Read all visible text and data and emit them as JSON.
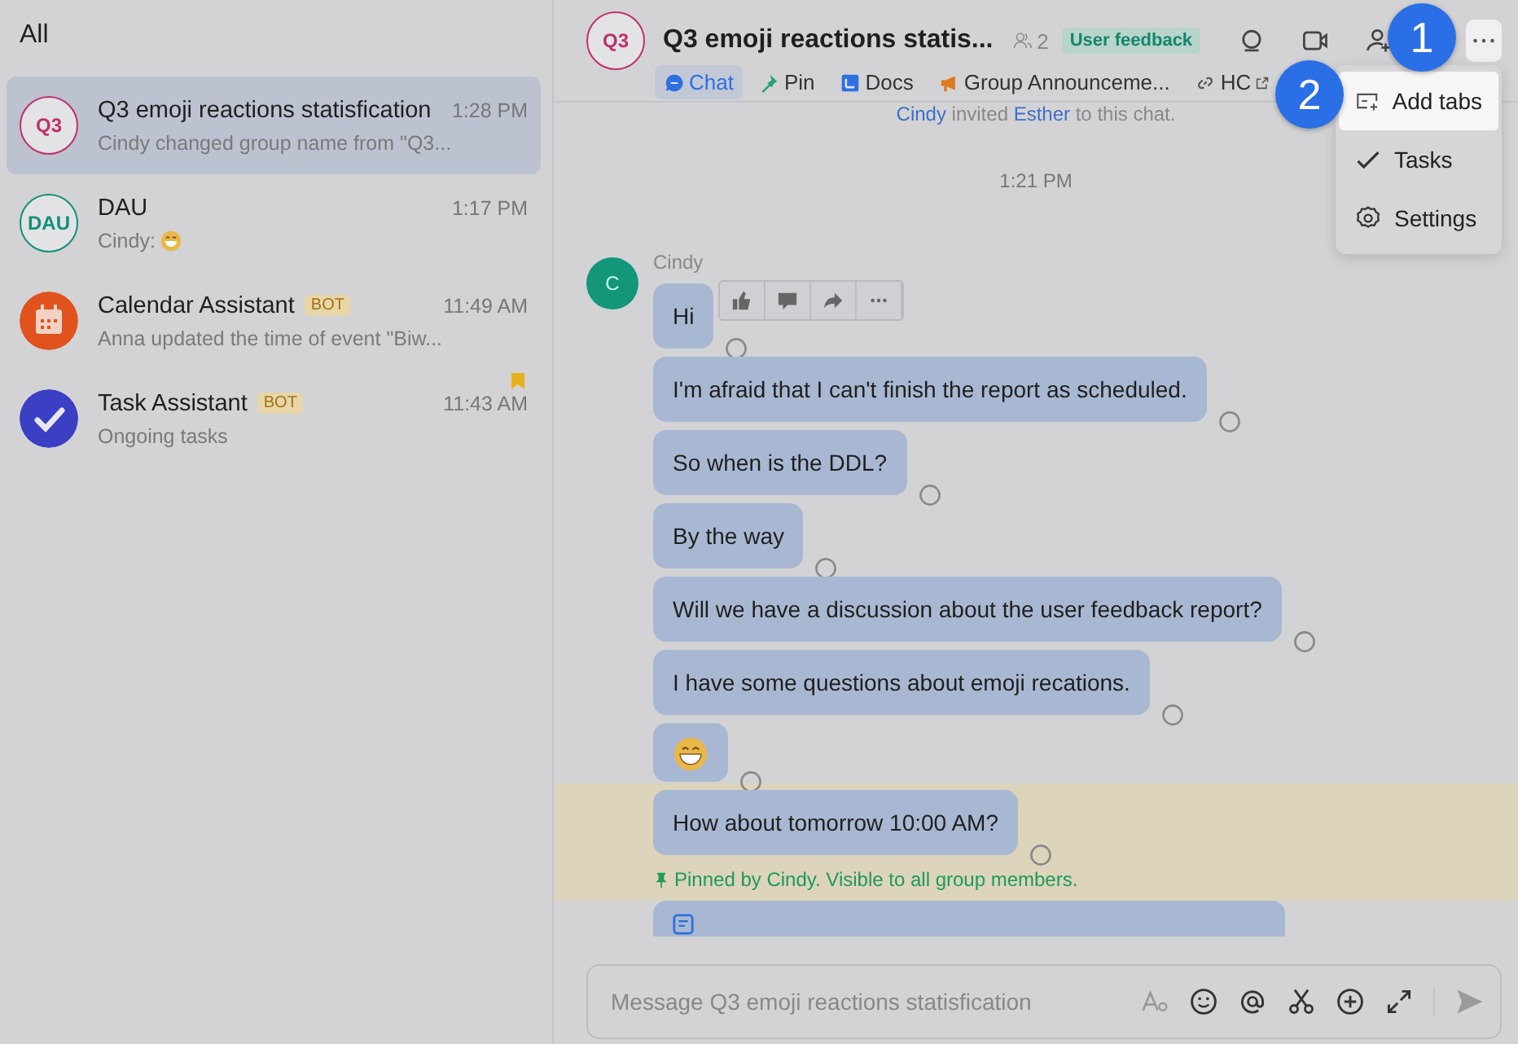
{
  "sidebar": {
    "title": "All",
    "chats": [
      {
        "name": "Q3 emoji reactions statisfication",
        "time": "1:28 PM",
        "preview": "Cindy changed group name from \"Q3...",
        "selected": true,
        "avatar": {
          "kind": "group",
          "text": "Q3",
          "color": "#c0306a"
        }
      },
      {
        "name": "DAU",
        "time": "1:17 PM",
        "preview": "Cindy:",
        "preview_emoji": true,
        "selected": false,
        "avatar": {
          "kind": "group",
          "text": "DAU",
          "color": "#11907a"
        }
      },
      {
        "name": "Calendar Assistant",
        "badge": "BOT",
        "time": "11:49 AM",
        "preview": "Anna updated the time of event \"Biw...",
        "selected": false,
        "avatar": {
          "kind": "calendar",
          "color": "#e0531e"
        }
      },
      {
        "name": "Task Assistant",
        "badge": "BOT",
        "time": "11:43 AM",
        "preview": "Ongoing tasks",
        "selected": false,
        "flagged": true,
        "avatar": {
          "kind": "task",
          "color": "#3a3fc4"
        }
      }
    ]
  },
  "chat": {
    "header": {
      "avatar_text": "Q3",
      "title": "Q3 emoji reactions statis...",
      "member_count": "2",
      "tag": "User feedback"
    },
    "tabs": [
      {
        "kind": "chat",
        "label": "Chat",
        "selected": true
      },
      {
        "kind": "pin",
        "label": "Pin",
        "selected": false
      },
      {
        "kind": "docs",
        "label": "Docs",
        "selected": false
      },
      {
        "kind": "announcement",
        "label": "Group Announceme...",
        "selected": false
      },
      {
        "kind": "link",
        "label": "HC",
        "selected": false
      }
    ],
    "notice": {
      "actor": "Cindy",
      "verb": "invited",
      "target": "Esther",
      "rest": "to this chat."
    },
    "time": "1:21 PM",
    "sender": {
      "initial": "C",
      "name": "Cindy"
    },
    "messages": [
      {
        "kind": "text",
        "text": "Hi",
        "toolbar": true,
        "pinned": false
      },
      {
        "kind": "text",
        "text": "I'm afraid that I can't finish the report as scheduled.",
        "toolbar": false,
        "pinned": false
      },
      {
        "kind": "text",
        "text": "So when is the DDL?",
        "toolbar": false,
        "pinned": false
      },
      {
        "kind": "text",
        "text": "By the way",
        "toolbar": false,
        "pinned": false
      },
      {
        "kind": "text",
        "text": "Will we have a discussion about the user feedback report?",
        "toolbar": false,
        "pinned": false
      },
      {
        "kind": "text",
        "text": "I have some questions about emoji recations.",
        "toolbar": false,
        "pinned": false
      },
      {
        "kind": "emoji",
        "toolbar": false,
        "pinned": false
      },
      {
        "kind": "text",
        "text": "How about tomorrow 10:00 AM?",
        "toolbar": false,
        "pinned": true
      },
      {
        "kind": "doc",
        "toolbar": false,
        "pinned": false
      }
    ],
    "pin_note": "Pinned by Cindy. Visible to all group members.",
    "composer": {
      "placeholder": "Message Q3 emoji reactions statisfication"
    }
  },
  "menu": {
    "items": [
      {
        "kind": "add",
        "label": "Add tabs",
        "highlighted": true
      },
      {
        "kind": "tasks",
        "label": "Tasks",
        "highlighted": false
      },
      {
        "kind": "settings",
        "label": "Settings",
        "highlighted": false
      }
    ]
  },
  "callouts": [
    "1",
    "2"
  ]
}
